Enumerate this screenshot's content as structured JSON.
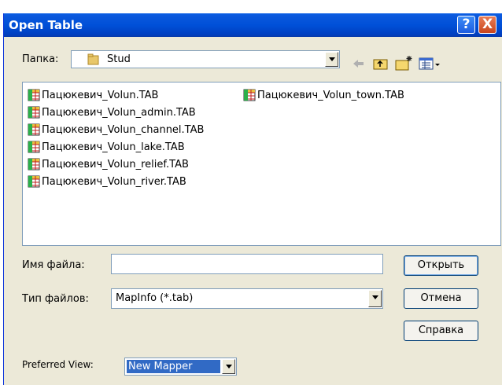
{
  "window": {
    "title": "Open Table",
    "help_glyph": "?",
    "close_glyph": "X"
  },
  "folder": {
    "label": "Папка:",
    "value": "Stud"
  },
  "toolbar": [
    "back-icon",
    "up-folder-icon",
    "new-folder-icon",
    "view-menu-icon"
  ],
  "files": [
    "Пацюкевич_Volun.TAB",
    "Пацюкевич_Volun_admin.TAB",
    "Пацюкевич_Volun_channel.TAB",
    "Пацюкевич_Volun_lake.TAB",
    "Пацюкевич_Volun_relief.TAB",
    "Пацюкевич_Volun_river.TAB",
    "Пацюкевич_Volun_town.TAB"
  ],
  "filename": {
    "label": "Имя файла:",
    "value": ""
  },
  "filetype": {
    "label": "Тип файлов:",
    "value": "MapInfo (*.tab)"
  },
  "buttons": {
    "open": "Открыть",
    "cancel": "Отмена",
    "help": "Справка"
  },
  "preferred_view": {
    "label": "Preferred View:",
    "value": "New Mapper"
  },
  "colors": {
    "title_bar": "#0054e3",
    "face": "#ece9d8",
    "selection": "#316ac5"
  }
}
